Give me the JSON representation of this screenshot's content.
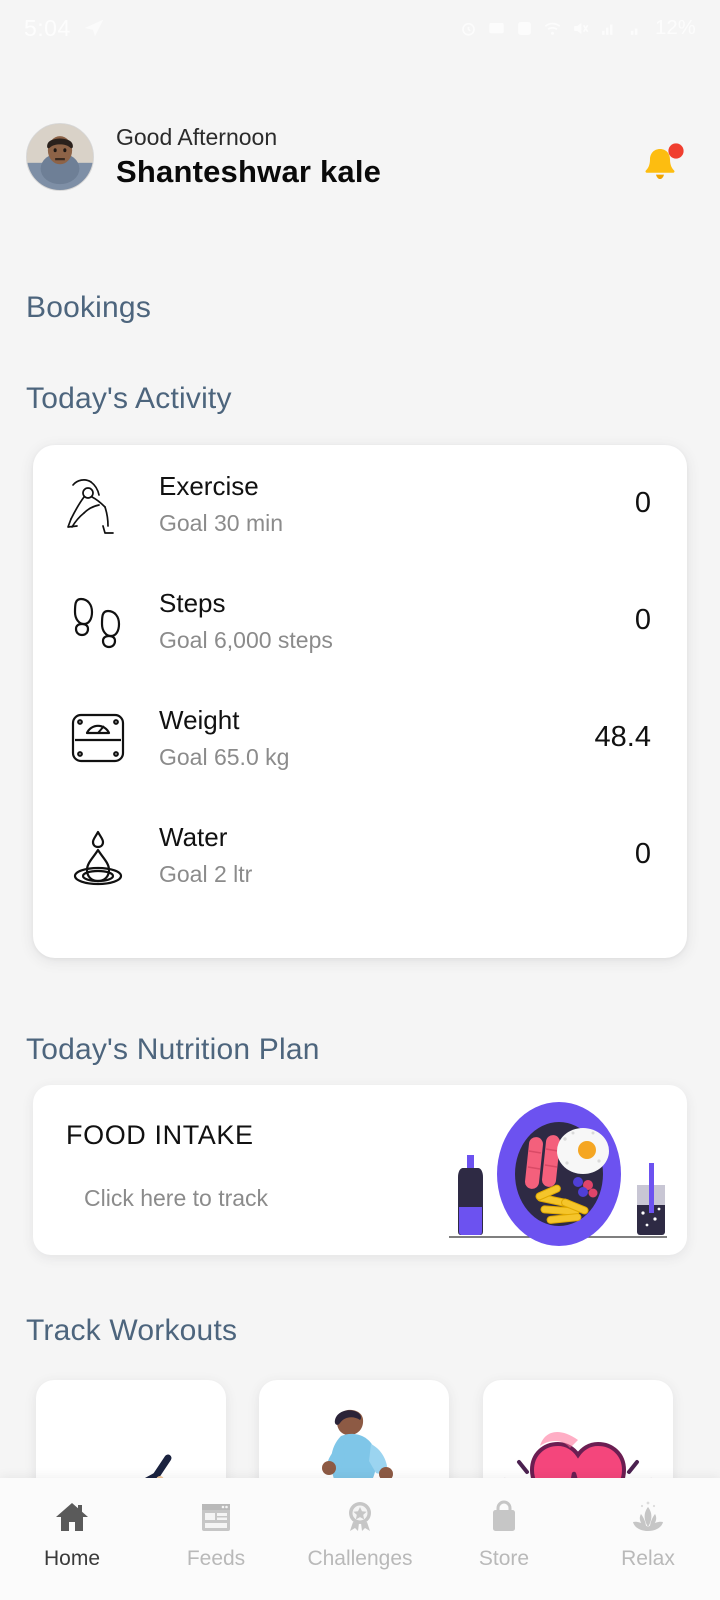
{
  "statusbar": {
    "time": "5:04",
    "battery": "12%",
    "icons": [
      "send-icon",
      "alarm-icon",
      "message-icon",
      "whatsapp-icon",
      "notification-icon",
      "wifi-icon",
      "mute-icon",
      "signal-one-icon",
      "signal-two-icon"
    ]
  },
  "header": {
    "greeting": "Good Afternoon",
    "user_name": "Shanteshwar kale",
    "avatar_name": "user-avatar",
    "bell_icon": "bell-icon",
    "bell_color": "#FDBD10",
    "badge_color": "#F03E2F",
    "has_notification": true
  },
  "sections": {
    "bookings": "Bookings",
    "activity": "Today's Activity",
    "nutrition": "Today's Nutrition Plan",
    "workouts": "Track Workouts",
    "heading_color": "#4d657d"
  },
  "activity": {
    "rows": [
      {
        "icon": "yoga-stretch-icon",
        "title": "Exercise",
        "goal": "Goal 30 min",
        "value": "0"
      },
      {
        "icon": "footprints-icon",
        "title": "Steps",
        "goal": "Goal 6,000 steps",
        "value": "0"
      },
      {
        "icon": "weighing-scale-icon",
        "title": "Weight",
        "goal": "Goal 65.0 kg",
        "value": "48.4"
      },
      {
        "icon": "water-drop-icon",
        "title": "Water",
        "goal": "Goal 2 ltr",
        "value": "0"
      }
    ]
  },
  "nutrition": {
    "title": "FOOD INTAKE",
    "subtitle": "Click here to track",
    "illustration": "food-plate-illustration",
    "plate_color": "#6C52F0"
  },
  "workouts": {
    "cards": [
      {
        "icon": "stretching-figure-icon"
      },
      {
        "icon": "running-person-icon"
      },
      {
        "icon": "heartbeat-heart-icon"
      }
    ]
  },
  "bottomnav": {
    "items": [
      {
        "label": "Home",
        "icon": "home-icon",
        "active": true
      },
      {
        "label": "Feeds",
        "icon": "feeds-icon",
        "active": false
      },
      {
        "label": "Challenges",
        "icon": "award-medal-icon",
        "active": false
      },
      {
        "label": "Store",
        "icon": "shopping-bag-icon",
        "active": false
      },
      {
        "label": "Relax",
        "icon": "lotus-icon",
        "active": false
      }
    ],
    "active_color": "#3a3a3a",
    "inactive_color": "#b9b9b9"
  }
}
